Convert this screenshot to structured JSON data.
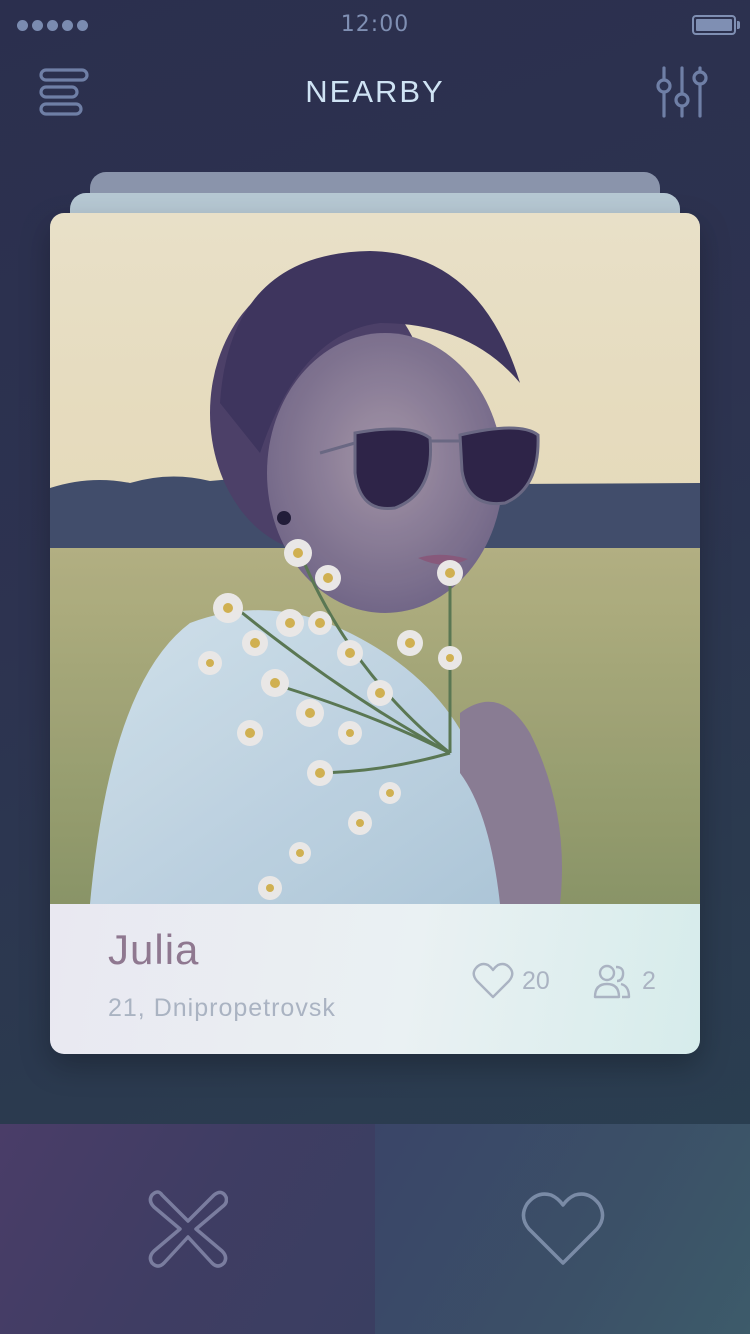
{
  "status_bar": {
    "time": "12:00",
    "signal_bars": 5,
    "battery_level": 1.0
  },
  "nav": {
    "title": "NEARBY",
    "menu_icon": "menu-icon",
    "filter_icon": "sliders-icon"
  },
  "profile": {
    "name": "Julia",
    "details": "21, Dnipropetrovsk",
    "likes": "20",
    "friends": "2",
    "likes_icon": "heart-outline-icon",
    "friends_icon": "people-icon"
  },
  "actions": {
    "dislike_icon": "close-icon",
    "like_icon": "heart-icon"
  },
  "colors": {
    "background": "#2d3350",
    "accent_text": "#cfe3f4",
    "name_text": "#8f7890",
    "muted_text": "#aab3c2",
    "dislike_bg": "#45406a",
    "like_bg": "#3b5067"
  }
}
